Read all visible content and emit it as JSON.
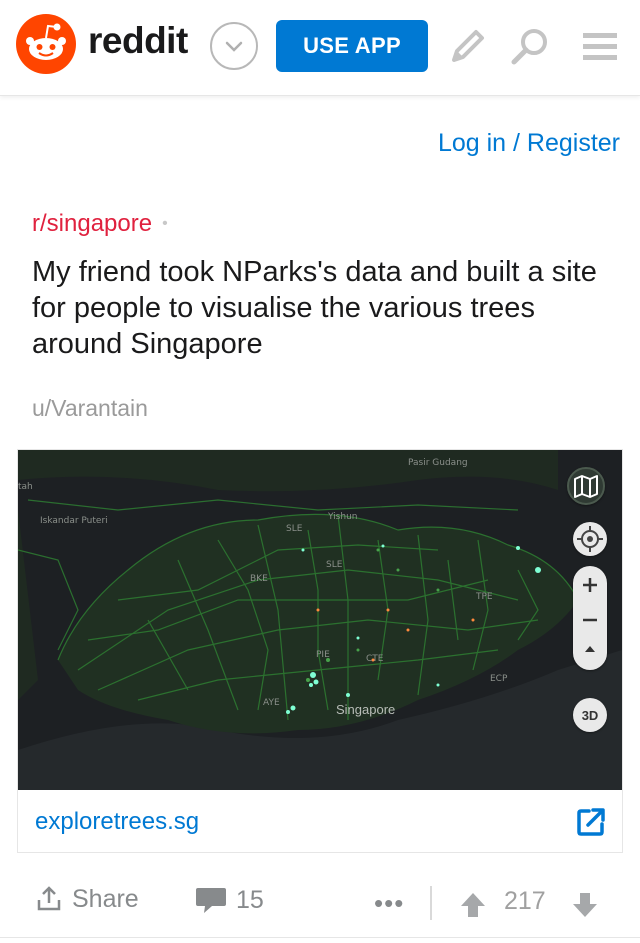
{
  "header": {
    "brand": "reddit",
    "use_app_label": "USE APP"
  },
  "auth": {
    "login_label": "Log in / Register"
  },
  "post": {
    "subreddit": "r/singapore",
    "separator": "•",
    "title": "My friend took NParks's data and built a site for people to visualise the various trees around Singapore",
    "author": "u/Varantain",
    "link_domain": "exploretrees.sg",
    "thumbnail": {
      "labels": {
        "pasir_gudang": "Pasir Gudang",
        "tah": "tah",
        "iskandar": "Iskandar Puteri",
        "yishun": "Yishun",
        "sle1": "SLE",
        "sle2": "SLE",
        "bke": "BKE",
        "tpe": "TPE",
        "pie": "PIE",
        "cte": "CTE",
        "ecp": "ECP",
        "aye": "AYE",
        "singapore": "Singapore"
      },
      "three_d_label": "3D"
    }
  },
  "actions": {
    "share_label": "Share",
    "comment_count": "15",
    "more_label": "•••",
    "score": "217"
  },
  "colors": {
    "brand_orange": "#ff4500",
    "accent_blue": "#0079d3",
    "subreddit_red": "#e0213e",
    "map_green": "#2f8f2f"
  }
}
